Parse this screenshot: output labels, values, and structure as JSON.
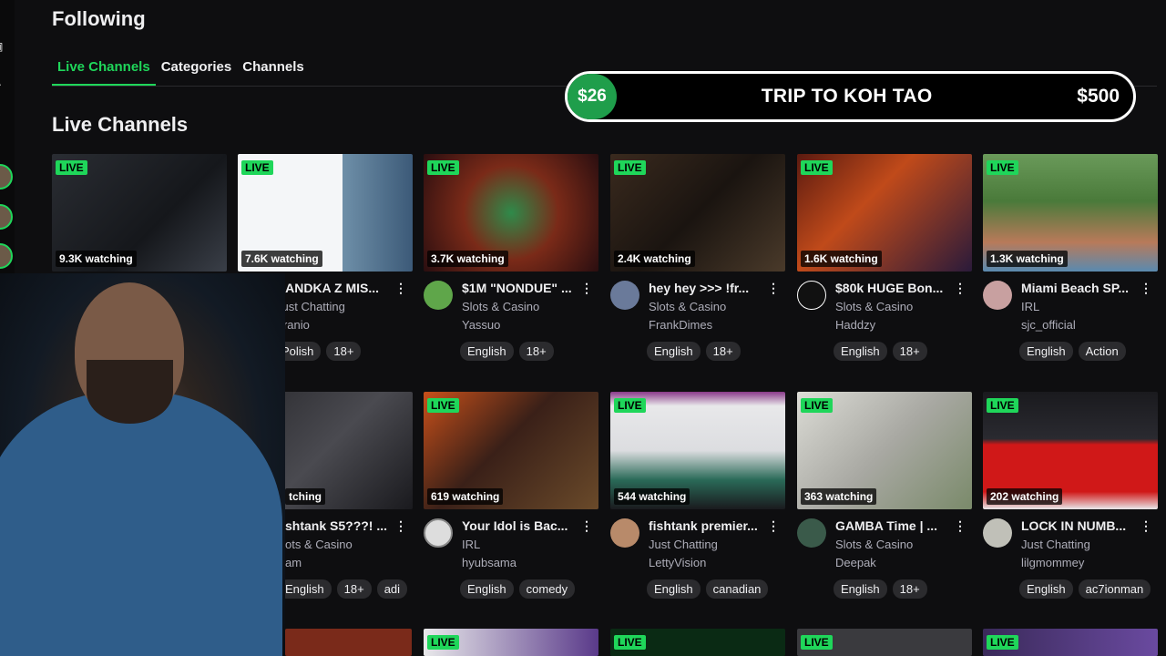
{
  "page_title": "Following",
  "tabs": [
    {
      "label": "Live Channels",
      "active": true
    },
    {
      "label": "Categories",
      "active": false
    },
    {
      "label": "Channels",
      "active": false
    }
  ],
  "section_title": "Live Channels",
  "goal": {
    "current": "$26",
    "title": "TRIP TO KOH TAO",
    "target": "$500",
    "accent": "#1f9e4b"
  },
  "live_label": "LIVE",
  "colors": {
    "accent": "#1fd65a",
    "background": "#0e0e10",
    "tag_bg": "#2b2b2e"
  },
  "row1": [
    {
      "watching": "9.3K watching",
      "title": "",
      "category": "",
      "streamer": "",
      "tags": []
    },
    {
      "watching": "7.6K watching",
      "title": "RANDKA Z MIS...",
      "category": "Just Chatting",
      "streamer": "Franio",
      "tags": [
        "Polish",
        "18+"
      ]
    },
    {
      "watching": "3.7K watching",
      "title": "$1M \"NONDUE\" ...",
      "category": "Slots & Casino",
      "streamer": "Yassuo",
      "tags": [
        "English",
        "18+"
      ]
    },
    {
      "watching": "2.4K watching",
      "title": "hey hey >>> !fr...",
      "category": "Slots & Casino",
      "streamer": "FrankDimes",
      "tags": [
        "English",
        "18+"
      ]
    },
    {
      "watching": "1.6K watching",
      "title": "$80k HUGE Bon...",
      "category": "Slots & Casino",
      "streamer": "Haddzy",
      "tags": [
        "English",
        "18+"
      ]
    },
    {
      "watching": "1.3K watching",
      "title": "Miami Beach SP...",
      "category": "IRL",
      "streamer": "sjc_official",
      "tags": [
        "English",
        "Action"
      ]
    }
  ],
  "row2": [
    {
      "watching": "tching",
      "title": "shtank S5???! ...",
      "category": "ots & Casino",
      "streamer": "am",
      "tags": [
        "English",
        "18+",
        "adi"
      ]
    },
    {
      "watching": "619 watching",
      "title": "Your Idol is Bac...",
      "category": "IRL",
      "streamer": "hyubsama",
      "tags": [
        "English",
        "comedy"
      ]
    },
    {
      "watching": "544 watching",
      "title": "fishtank premier...",
      "category": "Just Chatting",
      "streamer": "LettyVision",
      "tags": [
        "English",
        "canadian"
      ]
    },
    {
      "watching": "363 watching",
      "title": "GAMBA Time | ...",
      "category": "Slots & Casino",
      "streamer": "Deepak",
      "tags": [
        "English",
        "18+"
      ]
    },
    {
      "watching": "202 watching",
      "title": "LOCK IN NUMB...",
      "category": "Just Chatting",
      "streamer": "lilgmommey",
      "tags": [
        "English",
        "ac7ionman"
      ]
    }
  ]
}
